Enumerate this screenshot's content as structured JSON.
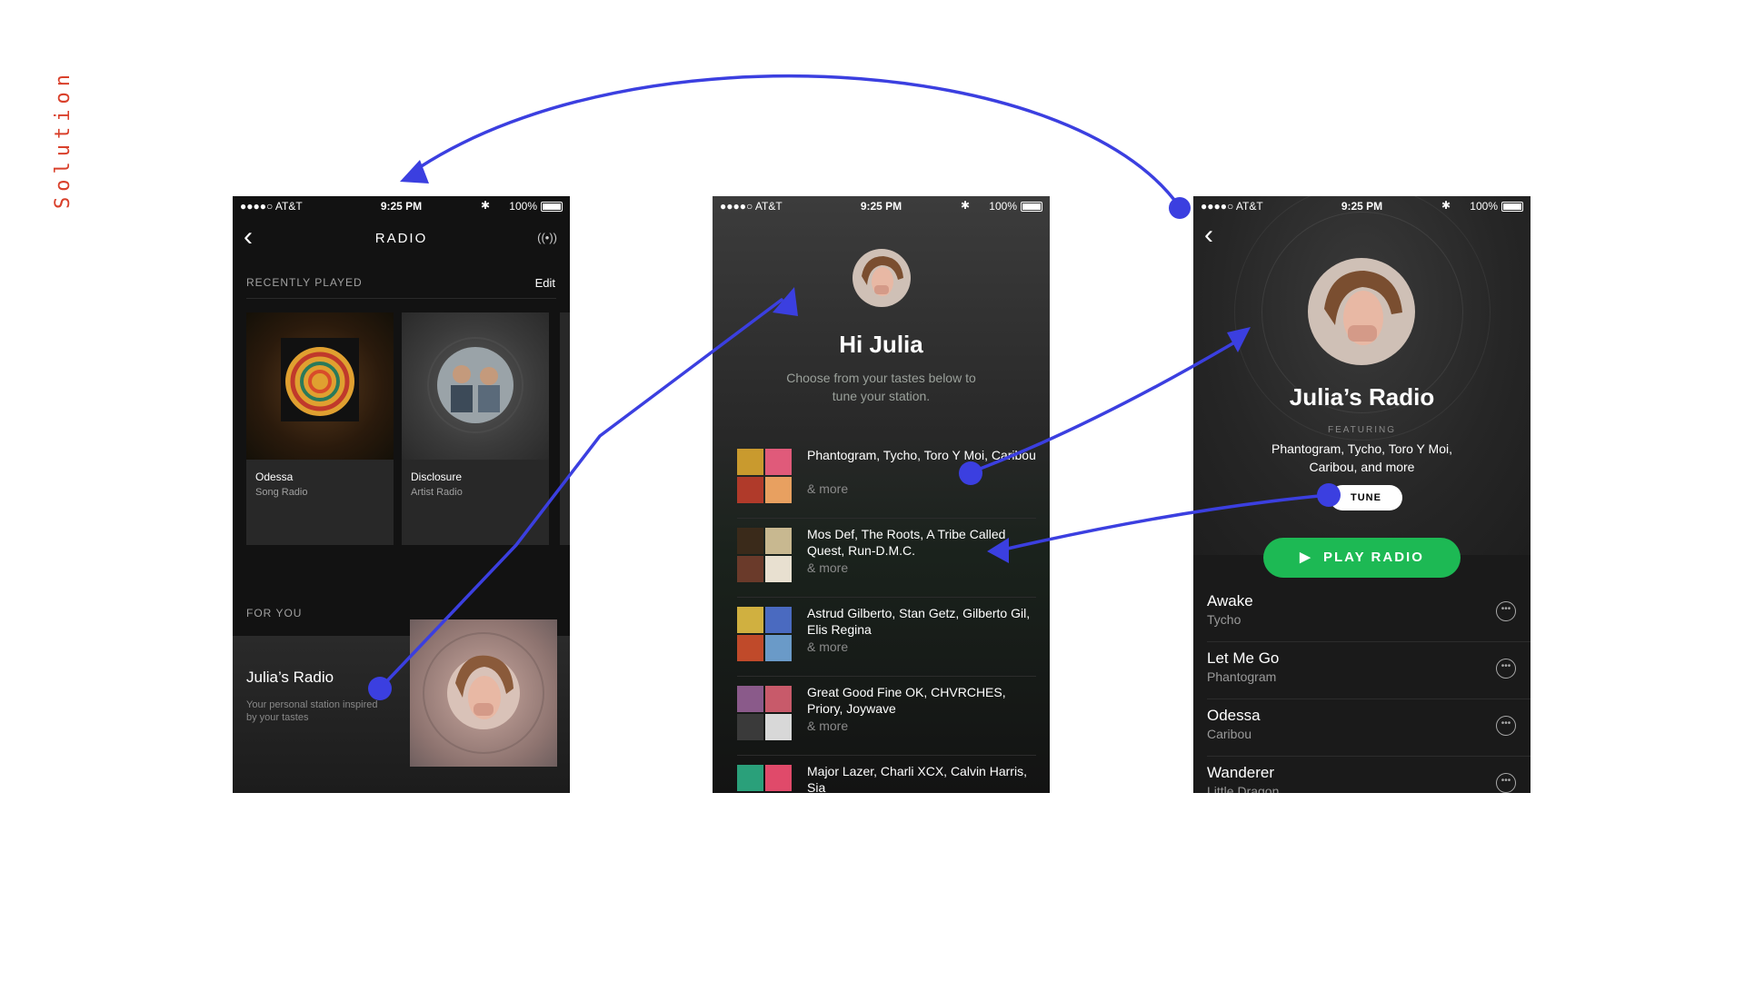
{
  "label": "Solution",
  "status": {
    "carrier": "●●●●○ AT&T",
    "time": "9:25 PM",
    "battery": "100%"
  },
  "radio_screen": {
    "title": "RADIO",
    "recently_played": "RECENTLY PLAYED",
    "edit": "Edit",
    "cards": [
      {
        "title": "Odessa",
        "subtitle": "Song Radio"
      },
      {
        "title": "Disclosure",
        "subtitle": "Artist Radio"
      }
    ],
    "for_you": "FOR YOU",
    "julia_title": "Julia’s Radio",
    "julia_sub": "Your personal station inspired by your tastes"
  },
  "tastes_screen": {
    "greeting": "Hi Julia",
    "description": "Choose from your tastes below to tune your station.",
    "more": "& more",
    "items": [
      {
        "artists": "Phantogram, Tycho, Toro Y Moi, Caribou"
      },
      {
        "artists": "Mos Def, The Roots, A Tribe Called Quest, Run-D.M.C."
      },
      {
        "artists": "Astrud Gilberto, Stan Getz, Gilberto Gil, Elis Regina"
      },
      {
        "artists": "Great Good Fine OK, CHVRCHES, Priory, Joywave"
      },
      {
        "artists": "Major Lazer, Charli XCX, Calvin Harris, Sia"
      }
    ]
  },
  "station_screen": {
    "title": "Julia’s Radio",
    "featuring": "FEATURING",
    "artists": "Phantogram, Tycho, Toro Y Moi, Caribou, and more",
    "tune": "TUNE",
    "play": "PLAY RADIO",
    "tracks": [
      {
        "name": "Awake",
        "artist": "Tycho"
      },
      {
        "name": "Let Me Go",
        "artist": "Phantogram"
      },
      {
        "name": "Odessa",
        "artist": "Caribou"
      },
      {
        "name": "Wanderer",
        "artist": "Little Dragon"
      }
    ]
  },
  "colors": {
    "accent_arrow": "#3b3fe0",
    "label": "#d9402b",
    "play_green": "#1db954"
  }
}
